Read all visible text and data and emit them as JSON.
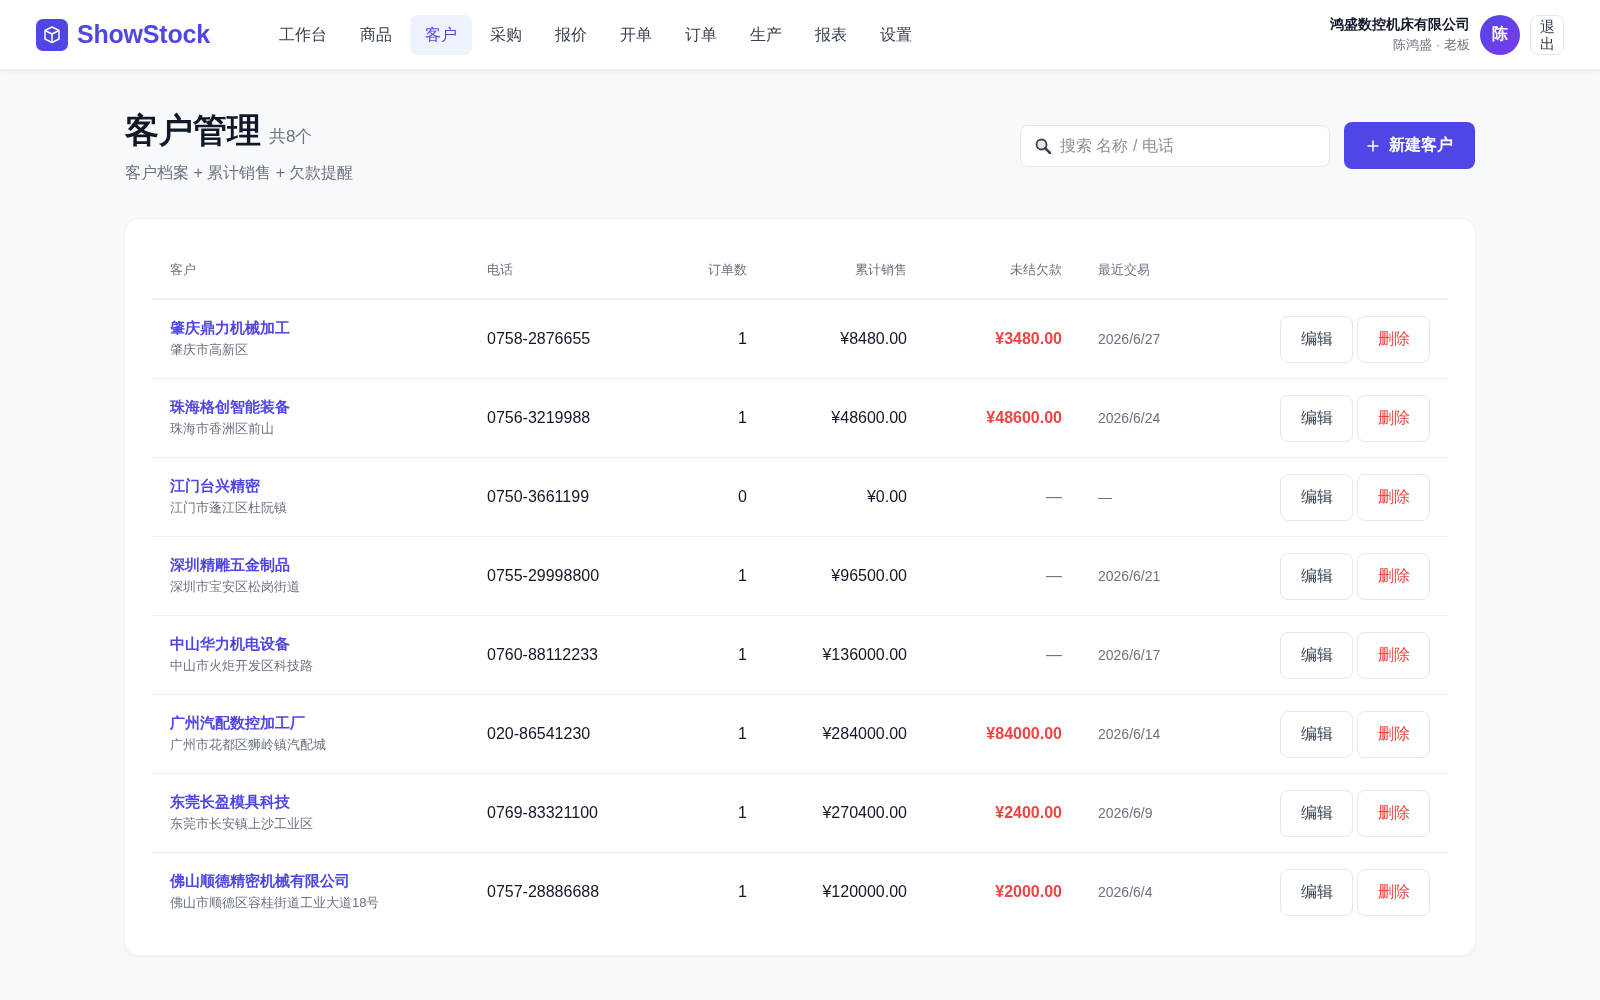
{
  "brand": {
    "name": "ShowStock"
  },
  "nav": [
    {
      "label": "工作台",
      "selected": false
    },
    {
      "label": "商品",
      "selected": false
    },
    {
      "label": "客户",
      "selected": true
    },
    {
      "label": "采购",
      "selected": false
    },
    {
      "label": "报价",
      "selected": false
    },
    {
      "label": "开单",
      "selected": false
    },
    {
      "label": "订单",
      "selected": false
    },
    {
      "label": "生产",
      "selected": false
    },
    {
      "label": "报表",
      "selected": false
    },
    {
      "label": "设置",
      "selected": false
    }
  ],
  "account": {
    "company": "鸿盛数控机床有限公司",
    "user": "陈鸿盛 · 老板",
    "avatar": "陈",
    "logout": "退出"
  },
  "page": {
    "title": "客户管理",
    "count": "共8个",
    "subtitle": "客户档案 + 累计销售 + 欠款提醒"
  },
  "search": {
    "placeholder": "搜索 名称 / 电话"
  },
  "new_button": {
    "label": "新建客户"
  },
  "table": {
    "columns": [
      "客户",
      "电话",
      "订单数",
      "累计销售",
      "未结欠款",
      "最近交易"
    ],
    "rows": [
      {
        "name": "肇庆鼎力机械加工",
        "address": "肇庆市高新区",
        "phone": "0758-2876655",
        "orders": "1",
        "sales": "¥8480.00",
        "debt": "¥3480.00",
        "debt_outstanding": true,
        "last_trade": "2026/6/27",
        "actions": [
          {
            "kind": "edit",
            "label": "编辑"
          },
          {
            "kind": "delete",
            "label": "删除"
          }
        ]
      },
      {
        "name": "珠海格创智能装备",
        "address": "珠海市香洲区前山",
        "phone": "0756-3219988",
        "orders": "1",
        "sales": "¥48600.00",
        "debt": "¥48600.00",
        "debt_outstanding": true,
        "last_trade": "2026/6/24",
        "actions": [
          {
            "kind": "edit",
            "label": "编辑"
          },
          {
            "kind": "delete",
            "label": "删除"
          }
        ]
      },
      {
        "name": "江门台兴精密",
        "address": "江门市蓬江区杜阮镇",
        "phone": "0750-3661199",
        "orders": "0",
        "sales": "¥0.00",
        "debt": "—",
        "debt_outstanding": false,
        "last_trade": "—",
        "actions": [
          {
            "kind": "edit",
            "label": "编辑"
          },
          {
            "kind": "delete",
            "label": "删除"
          }
        ]
      },
      {
        "name": "深圳精雕五金制品",
        "address": "深圳市宝安区松岗街道",
        "phone": "0755-29998800",
        "orders": "1",
        "sales": "¥96500.00",
        "debt": "—",
        "debt_outstanding": false,
        "last_trade": "2026/6/21",
        "actions": [
          {
            "kind": "edit",
            "label": "编辑"
          },
          {
            "kind": "delete",
            "label": "删除"
          }
        ]
      },
      {
        "name": "中山华力机电设备",
        "address": "中山市火炬开发区科技路",
        "phone": "0760-88112233",
        "orders": "1",
        "sales": "¥136000.00",
        "debt": "—",
        "debt_outstanding": false,
        "last_trade": "2026/6/17",
        "actions": [
          {
            "kind": "edit",
            "label": "编辑"
          },
          {
            "kind": "delete",
            "label": "删除"
          }
        ]
      },
      {
        "name": "广州汽配数控加工厂",
        "address": "广州市花都区狮岭镇汽配城",
        "phone": "020-86541230",
        "orders": "1",
        "sales": "¥284000.00",
        "debt": "¥84000.00",
        "debt_outstanding": true,
        "last_trade": "2026/6/14",
        "actions": [
          {
            "kind": "edit",
            "label": "编辑"
          },
          {
            "kind": "delete",
            "label": "删除"
          }
        ]
      },
      {
        "name": "东莞长盈模具科技",
        "address": "东莞市长安镇上沙工业区",
        "phone": "0769-83321100",
        "orders": "1",
        "sales": "¥270400.00",
        "debt": "¥2400.00",
        "debt_outstanding": true,
        "last_trade": "2026/6/9",
        "actions": [
          {
            "kind": "edit",
            "label": "编辑"
          },
          {
            "kind": "delete",
            "label": "删除"
          }
        ]
      },
      {
        "name": "佛山顺德精密机械有限公司",
        "address": "佛山市顺德区容桂街道工业大道18号",
        "phone": "0757-28886688",
        "orders": "1",
        "sales": "¥120000.00",
        "debt": "¥2000.00",
        "debt_outstanding": true,
        "last_trade": "2026/6/4",
        "actions": [
          {
            "kind": "edit",
            "label": "编辑"
          },
          {
            "kind": "delete",
            "label": "删除"
          }
        ]
      }
    ]
  }
}
